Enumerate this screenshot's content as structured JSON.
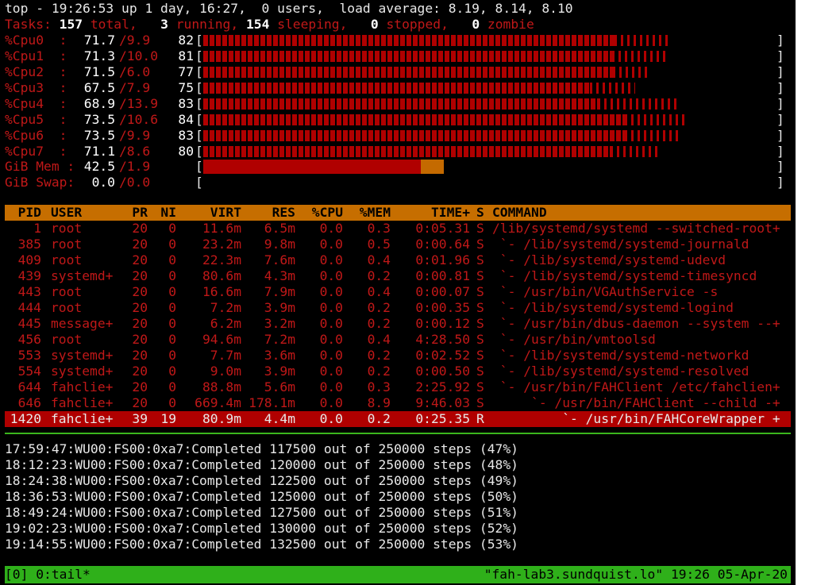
{
  "summary": {
    "line1": "top - 19:26:53 up 1 day, 16:27,  0 users,  load average: 8.19, 8.14, 8.10",
    "tasks_label": "Tasks:",
    "tasks_total": "157",
    "total_label": " total,",
    "tasks_running": "3",
    "running_label": " running,",
    "tasks_sleeping": "154",
    "sleeping_label": " sleeping,",
    "tasks_stopped": "0",
    "stopped_label": " stopped,",
    "tasks_zombie": "0",
    "zombie_label": " zombie"
  },
  "cpus": [
    {
      "label": "%Cpu0  :",
      "usr": "71.7",
      "sys": "/9.9",
      "total": "82",
      "usr_pct": 71.7,
      "sys_pct": 9.9
    },
    {
      "label": "%Cpu1  :",
      "usr": "71.3",
      "sys": "/10.0",
      "total": "81",
      "usr_pct": 71.3,
      "sys_pct": 10.0
    },
    {
      "label": "%Cpu2  :",
      "usr": "71.5",
      "sys": "/6.0",
      "total": "77",
      "usr_pct": 71.5,
      "sys_pct": 6.0
    },
    {
      "label": "%Cpu3  :",
      "usr": "67.5",
      "sys": "/7.9",
      "total": "75",
      "usr_pct": 67.5,
      "sys_pct": 7.9
    },
    {
      "label": "%Cpu4  :",
      "usr": "68.9",
      "sys": "/13.9",
      "total": "83",
      "usr_pct": 68.9,
      "sys_pct": 13.9
    },
    {
      "label": "%Cpu5  :",
      "usr": "73.5",
      "sys": "/10.6",
      "total": "84",
      "usr_pct": 73.5,
      "sys_pct": 10.6
    },
    {
      "label": "%Cpu6  :",
      "usr": "73.5",
      "sys": "/9.9",
      "total": "83",
      "usr_pct": 73.5,
      "sys_pct": 9.9
    },
    {
      "label": "%Cpu7  :",
      "usr": "71.1",
      "sys": "/8.6",
      "total": "80",
      "usr_pct": 71.1,
      "sys_pct": 8.6
    }
  ],
  "mem": {
    "label": "GiB Mem :",
    "used": "42.5",
    "sep": "/1.9",
    "used_pct": 38,
    "buf_pct": 4
  },
  "swap": {
    "label": "GiB Swap:",
    "used": "0.0",
    "sep": "/0.0"
  },
  "columns": {
    "pid": "PID",
    "user": "USER",
    "pr": "PR",
    "ni": "NI",
    "virt": "VIRT",
    "res": "RES",
    "cpu": "%CPU",
    "mem": "%MEM",
    "time": "TIME+",
    "s": "S",
    "cmd": "COMMAND"
  },
  "processes": [
    {
      "pid": "1",
      "user": "root",
      "pr": "20",
      "ni": "0",
      "virt": "11.6m",
      "res": "6.5m",
      "cpu": "0.0",
      "mem": "0.3",
      "time": "0:05.31",
      "s": "S",
      "cmd": "/lib/systemd/systemd --switched-root+"
    },
    {
      "pid": "385",
      "user": "root",
      "pr": "20",
      "ni": "0",
      "virt": "23.2m",
      "res": "9.8m",
      "cpu": "0.0",
      "mem": "0.5",
      "time": "0:00.64",
      "s": "S",
      "cmd": " `- /lib/systemd/systemd-journald"
    },
    {
      "pid": "409",
      "user": "root",
      "pr": "20",
      "ni": "0",
      "virt": "22.3m",
      "res": "7.6m",
      "cpu": "0.0",
      "mem": "0.4",
      "time": "0:01.96",
      "s": "S",
      "cmd": " `- /lib/systemd/systemd-udevd"
    },
    {
      "pid": "439",
      "user": "systemd+",
      "pr": "20",
      "ni": "0",
      "virt": "80.6m",
      "res": "4.3m",
      "cpu": "0.0",
      "mem": "0.2",
      "time": "0:00.81",
      "s": "S",
      "cmd": " `- /lib/systemd/systemd-timesyncd"
    },
    {
      "pid": "443",
      "user": "root",
      "pr": "20",
      "ni": "0",
      "virt": "16.6m",
      "res": "7.9m",
      "cpu": "0.0",
      "mem": "0.4",
      "time": "0:00.07",
      "s": "S",
      "cmd": " `- /usr/bin/VGAuthService -s"
    },
    {
      "pid": "444",
      "user": "root",
      "pr": "20",
      "ni": "0",
      "virt": "7.2m",
      "res": "3.9m",
      "cpu": "0.0",
      "mem": "0.2",
      "time": "0:00.35",
      "s": "S",
      "cmd": " `- /lib/systemd/systemd-logind"
    },
    {
      "pid": "445",
      "user": "message+",
      "pr": "20",
      "ni": "0",
      "virt": "6.2m",
      "res": "3.2m",
      "cpu": "0.0",
      "mem": "0.2",
      "time": "0:00.12",
      "s": "S",
      "cmd": " `- /usr/bin/dbus-daemon --system --+"
    },
    {
      "pid": "456",
      "user": "root",
      "pr": "20",
      "ni": "0",
      "virt": "94.6m",
      "res": "7.2m",
      "cpu": "0.0",
      "mem": "0.4",
      "time": "4:28.50",
      "s": "S",
      "cmd": " `- /usr/bin/vmtoolsd"
    },
    {
      "pid": "553",
      "user": "systemd+",
      "pr": "20",
      "ni": "0",
      "virt": "7.7m",
      "res": "3.6m",
      "cpu": "0.0",
      "mem": "0.2",
      "time": "0:02.52",
      "s": "S",
      "cmd": " `- /lib/systemd/systemd-networkd"
    },
    {
      "pid": "554",
      "user": "systemd+",
      "pr": "20",
      "ni": "0",
      "virt": "9.0m",
      "res": "3.9m",
      "cpu": "0.0",
      "mem": "0.2",
      "time": "0:00.50",
      "s": "S",
      "cmd": " `- /lib/systemd/systemd-resolved"
    },
    {
      "pid": "644",
      "user": "fahclie+",
      "pr": "20",
      "ni": "0",
      "virt": "88.8m",
      "res": "5.6m",
      "cpu": "0.0",
      "mem": "0.3",
      "time": "2:25.92",
      "s": "S",
      "cmd": " `- /usr/bin/FAHClient /etc/fahclien+"
    },
    {
      "pid": "646",
      "user": "fahclie+",
      "pr": "20",
      "ni": "0",
      "virt": "669.4m",
      "res": "178.1m",
      "cpu": "0.0",
      "mem": "8.9",
      "time": "9:46.03",
      "s": "S",
      "cmd": "     `- /usr/bin/FAHClient --child -+"
    },
    {
      "pid": "1420",
      "user": "fahclie+",
      "pr": "39",
      "ni": "19",
      "virt": "80.9m",
      "res": "4.4m",
      "cpu": "0.0",
      "mem": "0.2",
      "time": "0:25.35",
      "s": "R",
      "cmd": "         `- /usr/bin/FAHCoreWrapper +",
      "selected": true
    }
  ],
  "log_lines": [
    "17:59:47:WU00:FS00:0xa7:Completed 117500 out of 250000 steps (47%)",
    "18:12:23:WU00:FS00:0xa7:Completed 120000 out of 250000 steps (48%)",
    "18:24:38:WU00:FS00:0xa7:Completed 122500 out of 250000 steps (49%)",
    "18:36:53:WU00:FS00:0xa7:Completed 125000 out of 250000 steps (50%)",
    "18:49:24:WU00:FS00:0xa7:Completed 127500 out of 250000 steps (51%)",
    "19:02:23:WU00:FS00:0xa7:Completed 130000 out of 250000 steps (52%)",
    "19:14:55:WU00:FS00:0xa7:Completed 132500 out of 250000 steps (53%)"
  ],
  "status_bar": {
    "left": "[0] 0:tail*",
    "right": "\"fah-lab3.sundquist.lo\" 19:26 05-Apr-20"
  },
  "colors": {
    "background": "#000000",
    "red": "#c01818",
    "bar_red": "#b00000",
    "header_orange": "#c66e00",
    "status_green": "#2fb01a"
  }
}
